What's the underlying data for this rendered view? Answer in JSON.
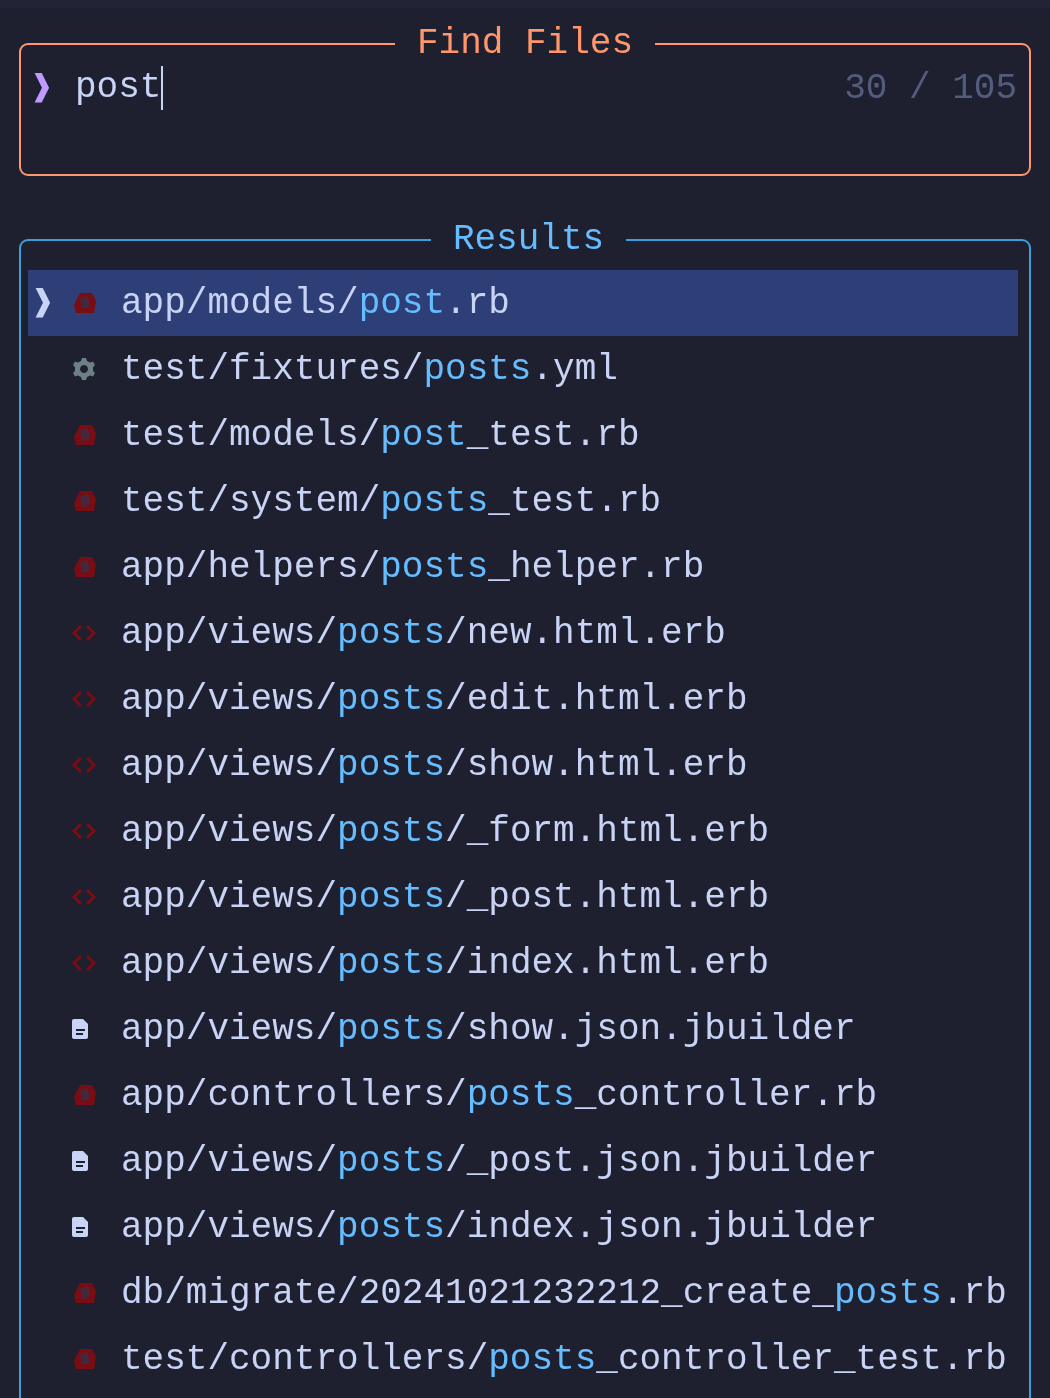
{
  "find_files": {
    "title": "Find Files",
    "prompt": "❱",
    "query": "post",
    "count": "30 / 105"
  },
  "results": {
    "title": "Results",
    "pointer": "❱",
    "rows": [
      {
        "kind": "ruby",
        "selected": true,
        "parts": [
          {
            "text": "app/models/",
            "match": false
          },
          {
            "text": "post",
            "match": true
          },
          {
            "text": ".rb",
            "match": false
          }
        ]
      },
      {
        "kind": "gear",
        "selected": false,
        "parts": [
          {
            "text": "test/fixtures/",
            "match": false
          },
          {
            "text": "posts",
            "match": true
          },
          {
            "text": ".yml",
            "match": false
          }
        ]
      },
      {
        "kind": "ruby",
        "selected": false,
        "parts": [
          {
            "text": "test/models/",
            "match": false
          },
          {
            "text": "post",
            "match": true
          },
          {
            "text": "_test.rb",
            "match": false
          }
        ]
      },
      {
        "kind": "ruby",
        "selected": false,
        "parts": [
          {
            "text": "test/system/",
            "match": false
          },
          {
            "text": "posts",
            "match": true
          },
          {
            "text": "_test.rb",
            "match": false
          }
        ]
      },
      {
        "kind": "ruby",
        "selected": false,
        "parts": [
          {
            "text": "app/helpers/",
            "match": false
          },
          {
            "text": "posts",
            "match": true
          },
          {
            "text": "_helper.rb",
            "match": false
          }
        ]
      },
      {
        "kind": "code",
        "selected": false,
        "parts": [
          {
            "text": "app/views/",
            "match": false
          },
          {
            "text": "posts",
            "match": true
          },
          {
            "text": "/new.html.erb",
            "match": false
          }
        ]
      },
      {
        "kind": "code",
        "selected": false,
        "parts": [
          {
            "text": "app/views/",
            "match": false
          },
          {
            "text": "posts",
            "match": true
          },
          {
            "text": "/edit.html.erb",
            "match": false
          }
        ]
      },
      {
        "kind": "code",
        "selected": false,
        "parts": [
          {
            "text": "app/views/",
            "match": false
          },
          {
            "text": "posts",
            "match": true
          },
          {
            "text": "/show.html.erb",
            "match": false
          }
        ]
      },
      {
        "kind": "code",
        "selected": false,
        "parts": [
          {
            "text": "app/views/",
            "match": false
          },
          {
            "text": "posts",
            "match": true
          },
          {
            "text": "/_form.html.erb",
            "match": false
          }
        ]
      },
      {
        "kind": "code",
        "selected": false,
        "parts": [
          {
            "text": "app/views/",
            "match": false
          },
          {
            "text": "posts",
            "match": true
          },
          {
            "text": "/_post.html.erb",
            "match": false
          }
        ]
      },
      {
        "kind": "code",
        "selected": false,
        "parts": [
          {
            "text": "app/views/",
            "match": false
          },
          {
            "text": "posts",
            "match": true
          },
          {
            "text": "/index.html.erb",
            "match": false
          }
        ]
      },
      {
        "kind": "file",
        "selected": false,
        "parts": [
          {
            "text": "app/views/",
            "match": false
          },
          {
            "text": "posts",
            "match": true
          },
          {
            "text": "/show.json.jbuilder",
            "match": false
          }
        ]
      },
      {
        "kind": "ruby",
        "selected": false,
        "parts": [
          {
            "text": "app/controllers/",
            "match": false
          },
          {
            "text": "posts",
            "match": true
          },
          {
            "text": "_controller.rb",
            "match": false
          }
        ]
      },
      {
        "kind": "file",
        "selected": false,
        "parts": [
          {
            "text": "app/views/",
            "match": false
          },
          {
            "text": "posts",
            "match": true
          },
          {
            "text": "/_post.json.jbuilder",
            "match": false
          }
        ]
      },
      {
        "kind": "file",
        "selected": false,
        "parts": [
          {
            "text": "app/views/",
            "match": false
          },
          {
            "text": "posts",
            "match": true
          },
          {
            "text": "/index.json.jbuilder",
            "match": false
          }
        ]
      },
      {
        "kind": "ruby",
        "selected": false,
        "parts": [
          {
            "text": "db/migrate/20241021232212_create_",
            "match": false
          },
          {
            "text": "posts",
            "match": true
          },
          {
            "text": ".rb",
            "match": false
          }
        ]
      },
      {
        "kind": "ruby",
        "selected": false,
        "parts": [
          {
            "text": "test/controllers/",
            "match": false
          },
          {
            "text": "posts",
            "match": true
          },
          {
            "text": "_controller_test.rb",
            "match": false
          }
        ]
      }
    ]
  }
}
